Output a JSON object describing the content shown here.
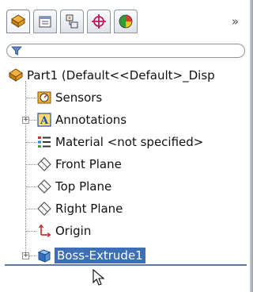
{
  "tabs": [
    {
      "name": "feature-manager-tab",
      "icon": "feature-tree-icon",
      "active": true
    },
    {
      "name": "property-manager-tab",
      "icon": "property-icon",
      "active": false
    },
    {
      "name": "configuration-manager-tab",
      "icon": "configuration-icon",
      "active": false
    },
    {
      "name": "dimxpert-manager-tab",
      "icon": "crosshair-icon",
      "active": false
    },
    {
      "name": "display-manager-tab",
      "icon": "display-pie-icon",
      "active": false
    }
  ],
  "more_label": "»",
  "tree": {
    "root_label": "Part1  (Default<<Default>_Disp",
    "items": [
      {
        "label": "Sensors",
        "icon": "sensor-icon",
        "expandable": false
      },
      {
        "label": "Annotations",
        "icon": "annotations-icon",
        "expandable": true
      },
      {
        "label": "Material <not specified>",
        "icon": "material-icon",
        "expandable": false
      },
      {
        "label": "Front Plane",
        "icon": "plane-icon",
        "expandable": false
      },
      {
        "label": "Top Plane",
        "icon": "plane-icon",
        "expandable": false
      },
      {
        "label": "Right Plane",
        "icon": "plane-icon",
        "expandable": false
      },
      {
        "label": "Origin",
        "icon": "origin-icon",
        "expandable": false
      },
      {
        "label": "Boss-Extrude1",
        "icon": "boss-extrude-icon",
        "expandable": true,
        "selected": true
      }
    ]
  },
  "colors": {
    "selection": "#3d6fb6",
    "rollback_bar": "#5f7ca6"
  }
}
